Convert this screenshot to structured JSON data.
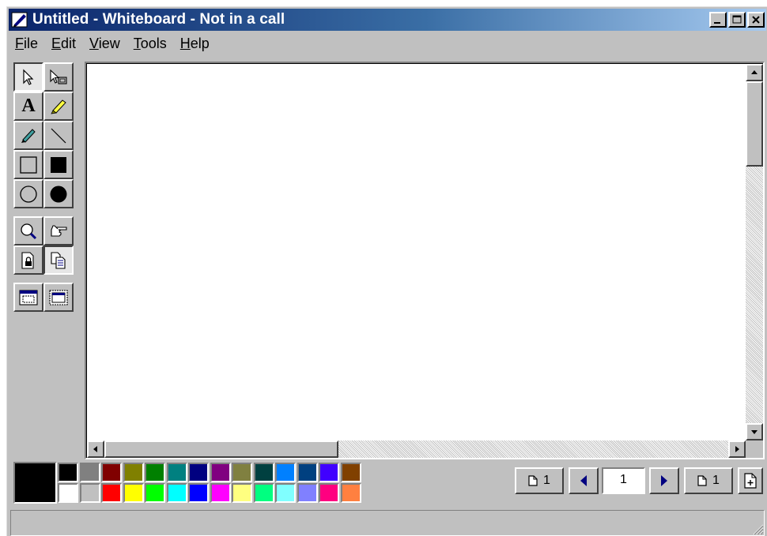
{
  "window": {
    "title": "Untitled - Whiteboard - Not in a call",
    "icon": "whiteboard-app-icon",
    "caption_buttons": [
      "minimize-icon",
      "maximize-icon",
      "close-icon"
    ]
  },
  "menu": [
    {
      "key": "F",
      "rest": "ile"
    },
    {
      "key": "E",
      "rest": "dit"
    },
    {
      "key": "V",
      "rest": "iew"
    },
    {
      "key": "T",
      "rest": "ools"
    },
    {
      "key": "H",
      "rest": "elp"
    }
  ],
  "tools": {
    "selector": "arrow-pointer-icon",
    "select_area": "select-area-icon",
    "text": "A",
    "highlighter": "highlighter-icon",
    "pen": "pen-icon",
    "line": "line-icon",
    "unfilled_rectangle": "rectangle-outline-icon",
    "filled_rectangle": "rectangle-filled-icon",
    "unfilled_ellipse": "ellipse-outline-icon",
    "filled_ellipse": "ellipse-filled-icon",
    "zoom": "magnifier-icon",
    "remote_pointer": "pointing-hand-icon",
    "lock_contents": "lock-page-icon",
    "synchronize": "synchronize-pages-icon",
    "select_window": "select-window-icon",
    "select_area_capture": "select-area-capture-icon"
  },
  "palette": {
    "current": "#000000",
    "top": [
      "#000000",
      "#808080",
      "#800000",
      "#808000",
      "#008000",
      "#008080",
      "#000080",
      "#800080",
      "#808040",
      "#004040",
      "#0080ff",
      "#004080",
      "#4000ff",
      "#804000"
    ],
    "bottom": [
      "#ffffff",
      "#c0c0c0",
      "#ff0000",
      "#ffff00",
      "#00ff00",
      "#00ffff",
      "#0000ff",
      "#ff00ff",
      "#ffff80",
      "#00ff80",
      "#80ffff",
      "#8080ff",
      "#ff0080",
      "#ff8040"
    ]
  },
  "pages": {
    "first_page_label": "1",
    "current_page": "1",
    "last_page_label": "1"
  },
  "status": {
    "text": ""
  }
}
